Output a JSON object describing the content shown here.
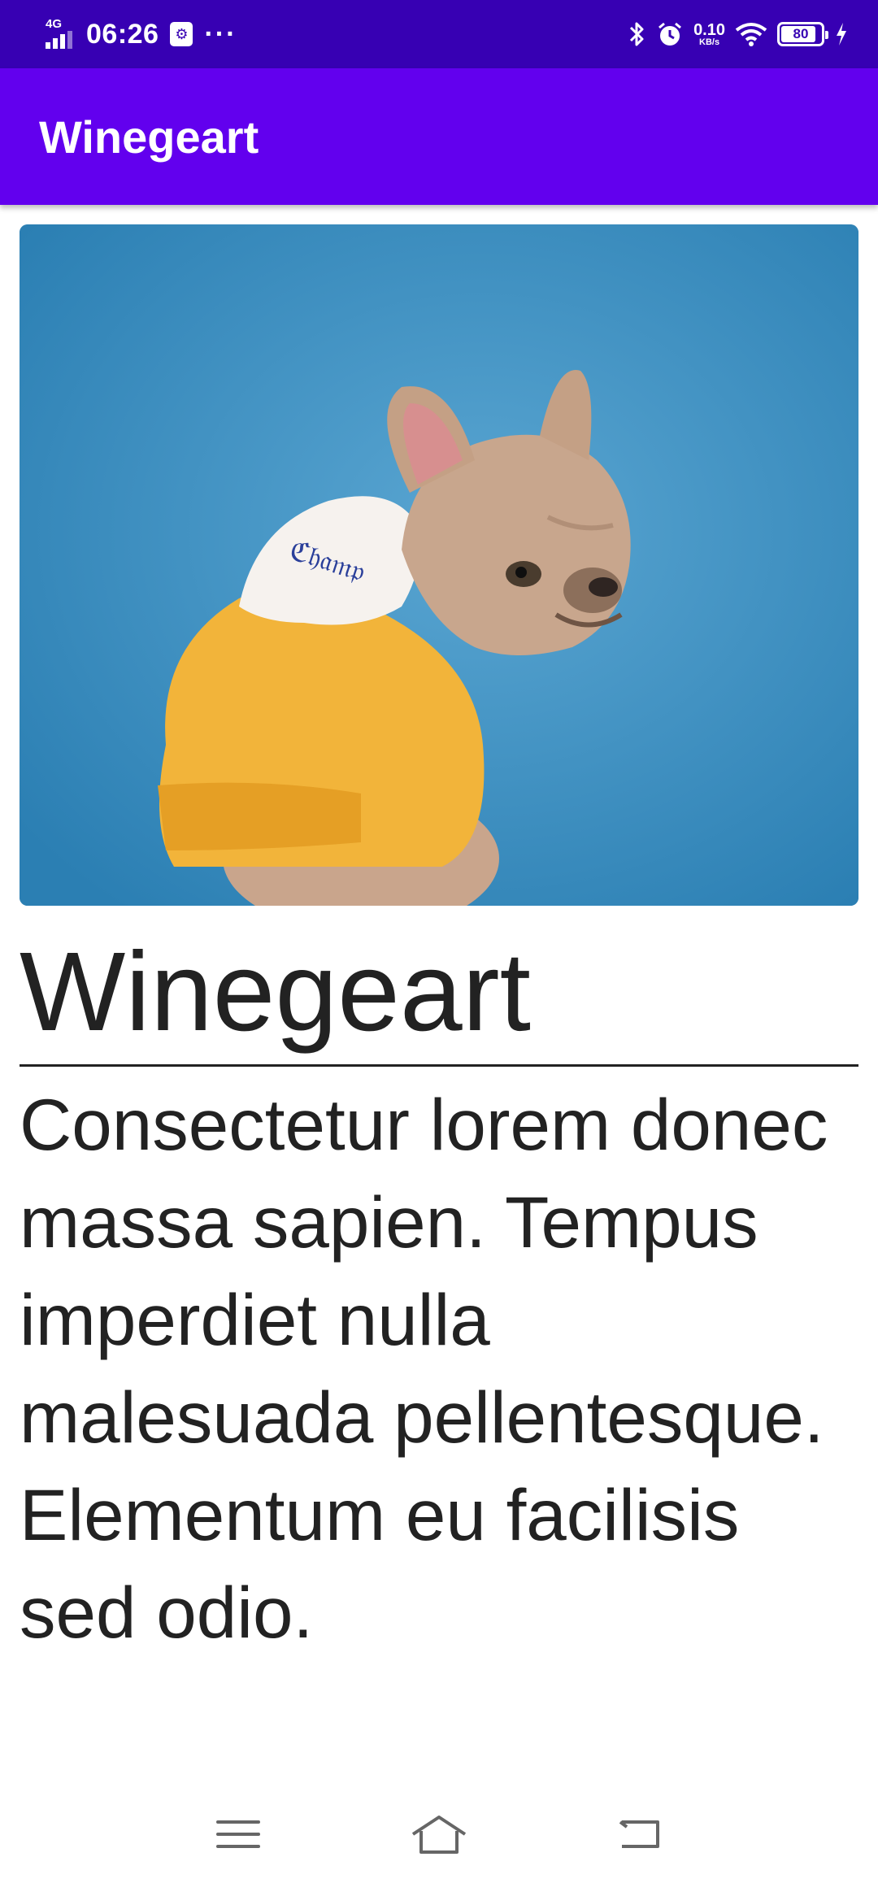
{
  "status_bar": {
    "network_type": "4G",
    "time": "06:26",
    "usb_icon": "usb-debug-icon",
    "more_icon": "more-dots-icon",
    "icons": [
      "bluetooth-icon",
      "alarm-icon",
      "wifi-icon",
      "charging-icon"
    ],
    "speed_value": "0.10",
    "speed_unit": "KB/s",
    "battery_level": "80"
  },
  "app_bar": {
    "title": "Winegeart",
    "background_color": "#6200ee"
  },
  "status_bar_color": "#3700b3",
  "content": {
    "image": "dog-in-yellow-hoodie-photo",
    "heading": "Winegeart",
    "body": "Consectetur lorem donec massa sapien. Tempus imperdiet nulla malesuada pellentesque. Elementum eu facilisis sed odio."
  },
  "nav_bar": {
    "buttons": [
      "menu-icon",
      "home-icon",
      "back-icon"
    ]
  }
}
